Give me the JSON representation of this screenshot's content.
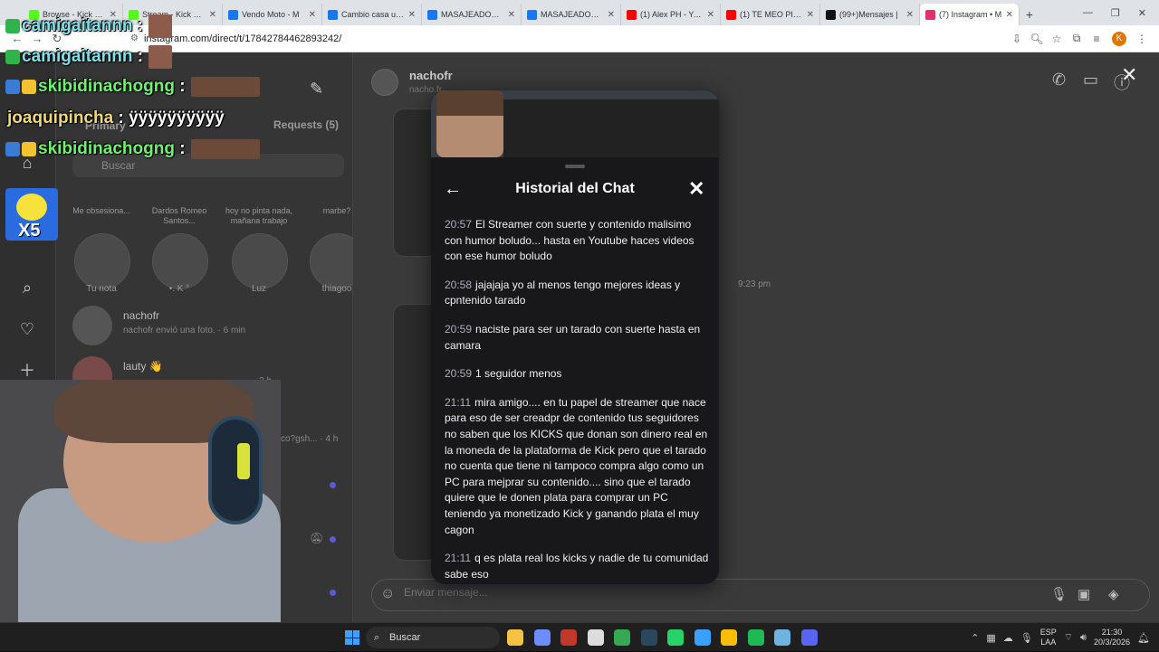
{
  "browser": {
    "tabs": [
      {
        "title": "Browse - Kick Stre",
        "color": "#53fc18"
      },
      {
        "title": "Stream - Kick Das",
        "color": "#53fc18"
      },
      {
        "title": "Vendo Moto - M",
        "color": "#1877f2"
      },
      {
        "title": "Cambio casa ubic",
        "color": "#1877f2"
      },
      {
        "title": "MASAJEADOR ÍN",
        "color": "#1877f2"
      },
      {
        "title": "MASAJEADOR ÍN",
        "color": "#1877f2"
      },
      {
        "title": "(1) Alex PH - YouT",
        "color": "#ff0000"
      },
      {
        "title": "(1) TE MEO PIÑER",
        "color": "#ff0000"
      },
      {
        "title": "(99+)Mensajes |",
        "color": "#111111"
      },
      {
        "title": "(7) Instagram • M",
        "color": "#e1306c"
      }
    ],
    "url": "instagram.com/direct/t/17842784462893242/"
  },
  "instagram": {
    "requests_label": "Requests (5)",
    "primary_label": "Primary",
    "search_placeholder": "Buscar",
    "notes": [
      {
        "text": "Me obsesiona...",
        "name": "Tu nota"
      },
      {
        "text": "Dardos\nRomeo Santos...",
        "name": "•. K °"
      },
      {
        "text": "hoy no pinta nada, mañana trabajo",
        "name": "Luz"
      },
      {
        "text": "marbe?",
        "name": "thiagoo"
      }
    ],
    "conversations": [
      {
        "name": "nachofr",
        "sub": "nachofr envió una foto. · 6 min"
      },
      {
        "name": "lauty 👋",
        "sub": "· 2 h"
      },
      {
        "name": "",
        "sub": "co?gsh... · 4 h"
      }
    ],
    "chat": {
      "name": "nachofr",
      "handle": "nacho.fr",
      "time": "9:23 pm",
      "input_placeholder": "Enviar mensaje..."
    }
  },
  "stream_chat": [
    {
      "user": "camigaitannn",
      "message": "",
      "color": "#7fe0e8"
    },
    {
      "user": "camigaitannn",
      "message": "",
      "color": "#7fe0e8"
    },
    {
      "user": "skibidinachogng",
      "message": "",
      "color": "#6ff26f"
    },
    {
      "user": "joaquipincha",
      "message": "ÿÿÿÿÿÿÿÿÿÿ",
      "color": "#f0d87a"
    },
    {
      "user": "skibidinachogng",
      "message": "",
      "color": "#6ff26f"
    }
  ],
  "badge_multiplier": "X5",
  "chat_history": {
    "title": "Historial del Chat",
    "messages": [
      {
        "time": "20:57",
        "text": "El Streamer con suerte y contenido malisimo con humor boludo... hasta en Youtube haces videos con ese humor boludo"
      },
      {
        "time": "20:58",
        "text": "jajajaja yo al menos tengo mejores ideas y cpntenido tarado"
      },
      {
        "time": "20:59",
        "text": "naciste para ser un tarado con suerte hasta en camara"
      },
      {
        "time": "20:59",
        "text": "1 seguidor menos"
      },
      {
        "time": "21:11",
        "text": "mira amigo.... en tu papel de streamer que nace para eso de ser creadpr de contenido tus seguidores no saben que los KICKS que donan son dinero real en la moneda de la plataforma de Kick pero que el tarado no cuenta que tiene ni tampoco compra algo como un PC para mejprar su contenido.... sino que el tarado quiere que le donen plata para comprar un PC teniendo ya monetizado Kick y ganando plata el muy cagon"
      },
      {
        "time": "21:11",
        "text": "q es plata real los kicks y nadie de tu comunidad sabe eso"
      }
    ]
  },
  "taskbar": {
    "search_label": "Buscar",
    "lang_line1": "ESP",
    "lang_line2": "LAA",
    "time": "21:30",
    "date": "20/3/2026",
    "apps": [
      {
        "name": "file-explorer-icon",
        "color": "#f5c242"
      },
      {
        "name": "copilot-icon",
        "color": "#6c8cff"
      },
      {
        "name": "winrar-icon",
        "color": "#c0392b"
      },
      {
        "name": "store-icon",
        "color": "#dddddd"
      },
      {
        "name": "chrome-icon",
        "color": "#34a853"
      },
      {
        "name": "steam-icon",
        "color": "#2a475e"
      },
      {
        "name": "whatsapp-icon",
        "color": "#25d366"
      },
      {
        "name": "f-app-icon",
        "color": "#3aa0ff"
      },
      {
        "name": "chrome-profile-icon",
        "color": "#fbbc05"
      },
      {
        "name": "spotify-icon",
        "color": "#1db954"
      },
      {
        "name": "notepad-icon",
        "color": "#6fb3e0"
      },
      {
        "name": "discord-icon",
        "color": "#5865f2"
      }
    ]
  }
}
